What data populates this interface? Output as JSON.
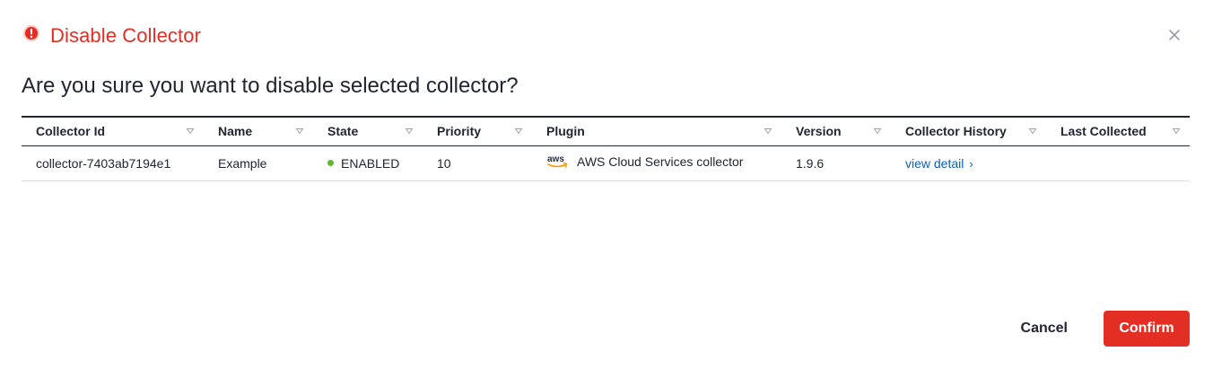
{
  "dialog": {
    "title": "Disable Collector",
    "question": "Are you sure you want to disable selected collector?",
    "alert_icon": "alert-circle-icon",
    "close_icon": "close-icon"
  },
  "table": {
    "columns": [
      "Collector Id",
      "Name",
      "State",
      "Priority",
      "Plugin",
      "Version",
      "Collector History",
      "Last Collected"
    ],
    "rows": [
      {
        "collector_id": "collector-7403ab7194e1",
        "name": "Example",
        "state": "ENABLED",
        "priority": "10",
        "plugin_logo": "aws-logo-icon",
        "plugin": "AWS Cloud Services collector",
        "version": "1.9.6",
        "history_link": "view detail",
        "last_collected": ""
      }
    ]
  },
  "footer": {
    "cancel_label": "Cancel",
    "confirm_label": "Confirm"
  },
  "colors": {
    "danger": "#e32e23",
    "link": "#0d61b5",
    "enabled": "#60b731",
    "text": "#222532"
  }
}
